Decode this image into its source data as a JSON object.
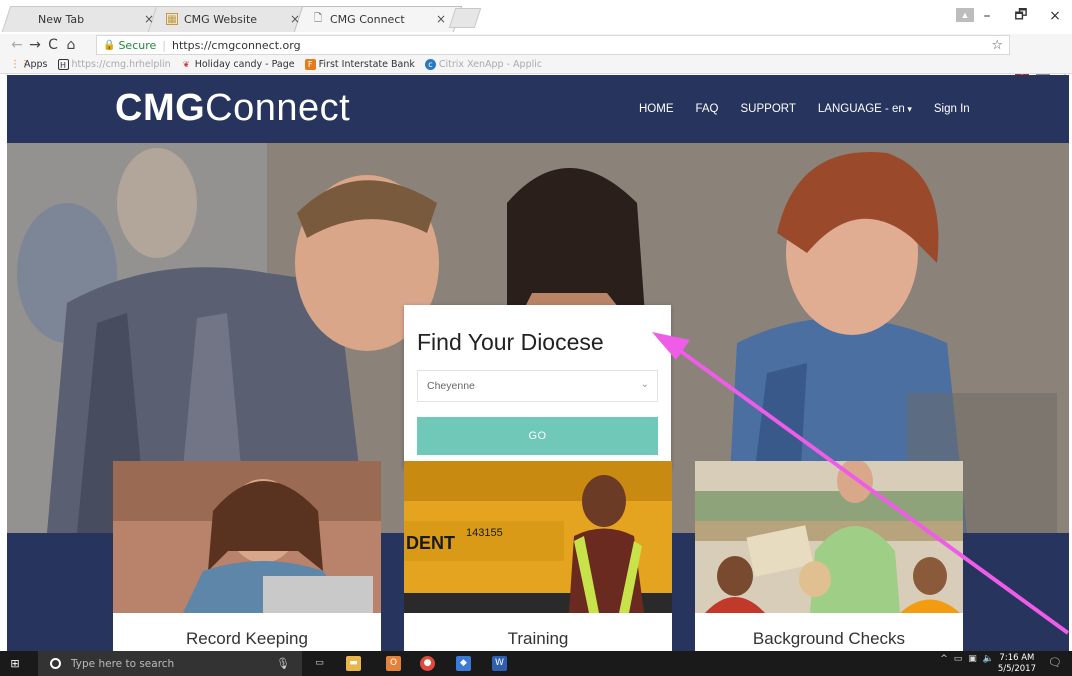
{
  "browser": {
    "tabs": [
      {
        "title": "New Tab",
        "icon": "blank"
      },
      {
        "title": "CMG Website",
        "icon": "grid-favicon"
      },
      {
        "title": "CMG Connect",
        "icon": "page-favicon",
        "active": true
      }
    ],
    "tab_close": "×",
    "url_secure_label": "Secure",
    "url": "https://cmgconnect.org",
    "bookmarks": [
      {
        "label": "Apps",
        "icon": "apps-grid-icon"
      },
      {
        "label": "https://cmg.hrhelplin",
        "icon": "h-favicon"
      },
      {
        "label": "Holiday candy - Page",
        "icon": "candy-favicon"
      },
      {
        "label": "First Interstate Bank",
        "icon": "bank-favicon"
      },
      {
        "label": "Citrix XenApp - Applic",
        "icon": "citrix-favicon"
      }
    ],
    "window_controls": {
      "minimize": "–",
      "restore": "🗗",
      "close": "×"
    }
  },
  "site": {
    "logo_bold": "CMG",
    "logo_light": "Connect",
    "nav": [
      "HOME",
      "FAQ",
      "SUPPORT",
      "LANGUAGE - en",
      "Sign In"
    ],
    "finder": {
      "title": "Find Your Diocese",
      "selected": "Cheyenne",
      "button": "GO"
    },
    "cards": [
      "Record Keeping",
      "Training",
      "Background Checks"
    ]
  },
  "taskbar": {
    "search_placeholder": "Type here to search",
    "time": "7:16 AM",
    "date": "5/5/2017"
  },
  "colors": {
    "navy": "#27345e",
    "teal_button": "#70c8b8",
    "annotation_arrow": "#ee5ce8"
  }
}
